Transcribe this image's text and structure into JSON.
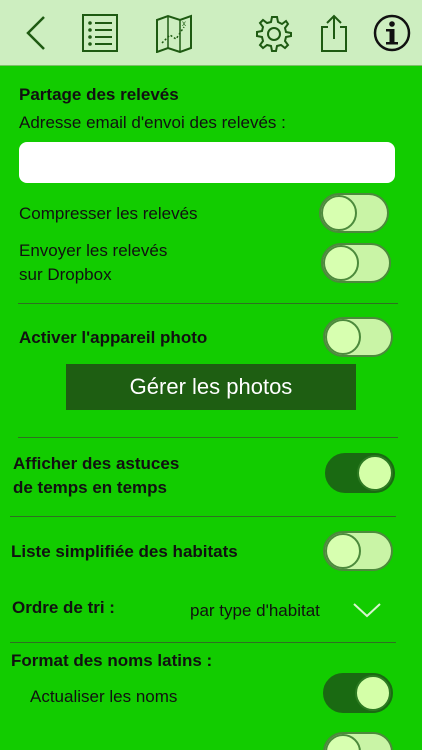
{
  "toolbar": {
    "icons": [
      "back-chevron-icon",
      "list-icon",
      "map-icon",
      "gear-icon",
      "share-icon",
      "info-icon"
    ]
  },
  "sharing": {
    "title": "Partage des relevés",
    "email_label": "Adresse email d'envoi des relevés :",
    "email_value": "",
    "compress_label": "Compresser les relevés",
    "compress_on": false,
    "dropbox_label_line1": "Envoyer les relevés",
    "dropbox_label_line2": "sur Dropbox",
    "dropbox_on": false
  },
  "photo": {
    "activate_label": "Activer l'appareil photo",
    "activate_on": false,
    "manage_button": "Gérer les photos"
  },
  "tips": {
    "label_line1": "Afficher des astuces",
    "label_line2": "de temps en temps",
    "on": true
  },
  "habitats": {
    "simplified_label": "Liste simplifiée des habitats",
    "simplified_on": false,
    "sort_label": "Ordre de tri :",
    "sort_value": "par type d'habitat"
  },
  "latin": {
    "title": "Format des noms latins :",
    "update_label": "Actualiser les noms",
    "update_on": true
  },
  "colors": {
    "background": "#12cc00",
    "toolbar": "#cdeec0",
    "toggle_on": "#1a6a12",
    "toggle_off": "#c9f4a6",
    "button": "#1e5e12"
  }
}
